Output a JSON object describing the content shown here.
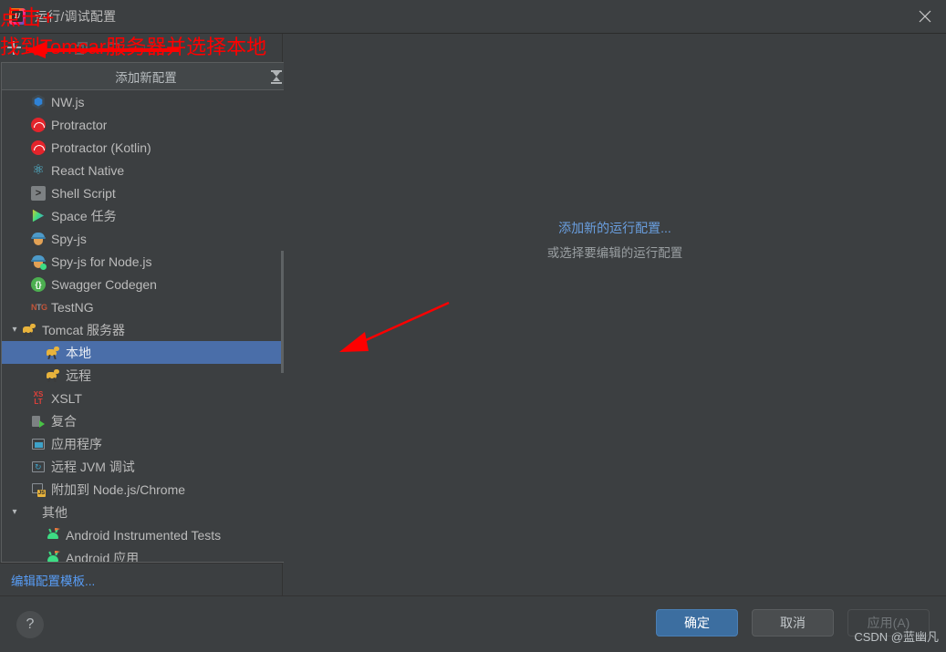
{
  "window": {
    "title": "运行/调试配置",
    "app_icon": "intellij-idea-icon",
    "close_icon": "close-icon"
  },
  "toolbar": {
    "items": [
      {
        "name": "add-configuration-button",
        "icon": "plus-icon"
      },
      {
        "name": "copy-configuration-button",
        "icon": "copy-icon"
      },
      {
        "name": "new-folder-button",
        "icon": "folder-plus-icon"
      },
      {
        "name": "sort-configurations-button",
        "icon": "sort-az-icon",
        "label": "a\nz"
      }
    ]
  },
  "popup": {
    "header_title": "添加新配置",
    "collapse_icon": "collapse-all-icon",
    "items": [
      {
        "label": "NW.js",
        "icon": "nwjs-icon",
        "indent": 1,
        "arrow": "",
        "selected": false
      },
      {
        "label": "Protractor",
        "icon": "protractor-icon",
        "indent": 1,
        "arrow": "",
        "selected": false
      },
      {
        "label": "Protractor (Kotlin)",
        "icon": "protractor-icon",
        "indent": 1,
        "arrow": "",
        "selected": false
      },
      {
        "label": "React Native",
        "icon": "react-native-icon",
        "indent": 1,
        "arrow": "",
        "selected": false
      },
      {
        "label": "Shell Script",
        "icon": "shell-script-icon",
        "indent": 1,
        "arrow": "",
        "selected": false
      },
      {
        "label": "Space 任务",
        "icon": "space-icon",
        "indent": 1,
        "arrow": "",
        "selected": false
      },
      {
        "label": "Spy-js",
        "icon": "spy-js-icon",
        "indent": 1,
        "arrow": "",
        "selected": false
      },
      {
        "label": "Spy-js for Node.js",
        "icon": "spy-js-node-icon",
        "indent": 1,
        "arrow": "",
        "selected": false
      },
      {
        "label": "Swagger Codegen",
        "icon": "swagger-icon",
        "indent": 1,
        "arrow": "",
        "selected": false
      },
      {
        "label": "TestNG",
        "icon": "testng-icon",
        "indent": 1,
        "arrow": "",
        "selected": false
      },
      {
        "label": "Tomcat 服务器",
        "icon": "tomcat-icon",
        "indent": 0,
        "arrow": "v",
        "selected": false
      },
      {
        "label": "本地",
        "icon": "tomcat-icon",
        "indent": 2,
        "arrow": "",
        "selected": true
      },
      {
        "label": "远程",
        "icon": "tomcat-icon",
        "indent": 2,
        "arrow": "",
        "selected": false
      },
      {
        "label": "XSLT",
        "icon": "xslt-icon",
        "indent": 1,
        "arrow": "",
        "selected": false
      },
      {
        "label": "复合",
        "icon": "compound-icon",
        "indent": 1,
        "arrow": "",
        "selected": false
      },
      {
        "label": "应用程序",
        "icon": "application-icon",
        "indent": 1,
        "arrow": "",
        "selected": false
      },
      {
        "label": "远程 JVM 调试",
        "icon": "remote-jvm-debug-icon",
        "indent": 1,
        "arrow": "",
        "selected": false
      },
      {
        "label": "附加到 Node.js/Chrome",
        "icon": "attach-node-chrome-icon",
        "indent": 1,
        "arrow": "",
        "selected": false
      },
      {
        "label": "其他",
        "icon": "",
        "indent": 0,
        "arrow": "v",
        "selected": false
      },
      {
        "label": "Android Instrumented Tests",
        "icon": "android-icon",
        "indent": 2,
        "arrow": "",
        "selected": false
      },
      {
        "label": "Android 应用",
        "icon": "android-icon",
        "indent": 2,
        "arrow": "",
        "selected": false
      }
    ],
    "scrollbar": {
      "thumb_top_pct": 34,
      "thumb_height_pct": 26
    }
  },
  "left_footer": {
    "edit_templates_label": "编辑配置模板..."
  },
  "right_panel": {
    "add_link": "添加新的运行配置...",
    "subtitle": "或选择要编辑的运行配置"
  },
  "bottom": {
    "help_label": "?",
    "ok_label": "确定",
    "cancel_label": "取消",
    "apply_label": "应用(A)",
    "watermark": "CSDN @蓝幽凡"
  },
  "annotations": {
    "click_plus": "点击+",
    "find_tomcat": "找到Tomcar服务器并选择本地",
    "color": "#fe0000"
  }
}
